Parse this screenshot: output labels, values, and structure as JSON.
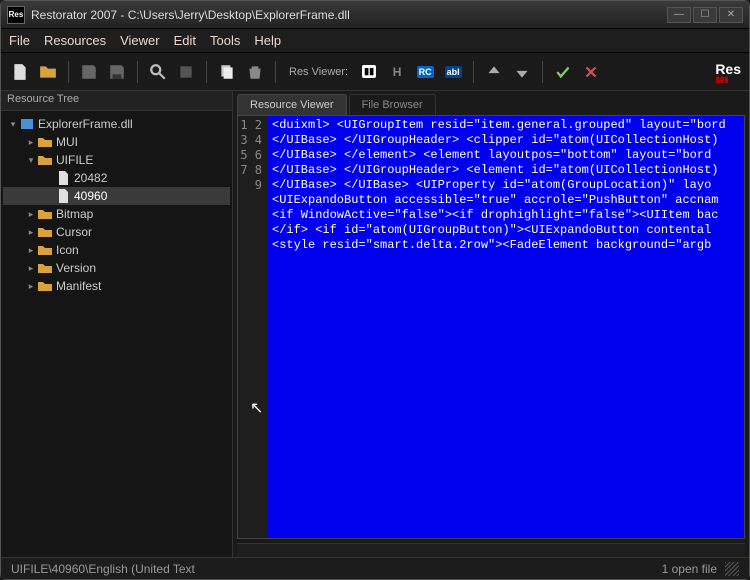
{
  "window": {
    "title": "Restorator 2007 - C:\\Users\\Jerry\\Desktop\\ExplorerFrame.dll",
    "logo_text": "Res"
  },
  "menus": [
    "File",
    "Resources",
    "Viewer",
    "Edit",
    "Tools",
    "Help"
  ],
  "toolbar": {
    "res_viewer_label": "Res Viewer:",
    "brand": "Res"
  },
  "tree": {
    "header": "Resource Tree",
    "root": "ExplorerFrame.dll",
    "items": [
      {
        "label": "MUI",
        "type": "folder",
        "depth": 1,
        "expanded": false
      },
      {
        "label": "UIFILE",
        "type": "folder",
        "depth": 1,
        "expanded": true
      },
      {
        "label": "20482",
        "type": "file",
        "depth": 2
      },
      {
        "label": "40960",
        "type": "file",
        "depth": 2,
        "selected": true
      },
      {
        "label": "Bitmap",
        "type": "folder",
        "depth": 1,
        "expanded": false
      },
      {
        "label": "Cursor",
        "type": "folder",
        "depth": 1,
        "expanded": false
      },
      {
        "label": "Icon",
        "type": "folder",
        "depth": 1,
        "expanded": false
      },
      {
        "label": "Version",
        "type": "folder",
        "depth": 1,
        "expanded": false
      },
      {
        "label": "Manifest",
        "type": "folder",
        "depth": 1,
        "expanded": false
      }
    ]
  },
  "tabs": {
    "active": "Resource Viewer",
    "inactive": "File Browser"
  },
  "code": {
    "lines": [
      "<duixml> <UIGroupItem resid=\"item.general.grouped\" layout=\"bord",
      "</UIBase> </UIGroupHeader> <clipper id=\"atom(UICollectionHost)",
      "</UIBase> </element> <element layoutpos=\"bottom\" layout=\"bord",
      "</UIBase> </UIGroupHeader> <element id=\"atom(UICollectionHost)",
      "</UIBase> </UIBase> <UIProperty id=\"atom(GroupLocation)\" layo",
      "<UIExpandoButton accessible=\"true\" accrole=\"PushButton\" accnam",
      "<if WindowActive=\"false\"><if drophighlight=\"false\"><UIItem bac",
      "</if> <if id=\"atom(UIGroupButton)\"><UIExpandoButton contental",
      "<style resid=\"smart.delta.2row\"><FadeElement background=\"argb"
    ]
  },
  "status": {
    "left": "UIFILE\\40960\\English (United Text",
    "right": "1 open file"
  }
}
